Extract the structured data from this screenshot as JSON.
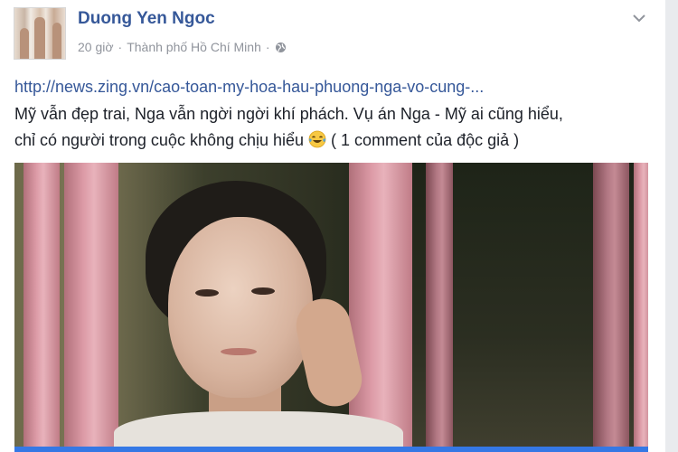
{
  "post": {
    "author": "Duong Yen Ngoc",
    "time": "20 giờ",
    "separator": "·",
    "location": "Thành phố Hồ Chí Minh",
    "separator2": "·",
    "privacy_icon": "globe-icon",
    "menu_icon": "chevron-down-icon",
    "shared_link": "http://news.zing.vn/cao-toan-my-hoa-hau-phuong-nga-vo-cung-...",
    "caption_line1": "Mỹ vẫn đẹp trai, Nga vẫn ngời ngời khí phách. Vụ án Nga - Mỹ ai cũng hiểu,",
    "caption_line2_before_emoji": "chỉ có người trong cuộc không chịu hiểu ",
    "caption_emoji": "tears-of-joy-emoji",
    "caption_line2_after_emoji": " ( 1 comment của độc giả )"
  },
  "colors": {
    "author_link": "#365899",
    "meta_text": "#90949c",
    "body_text": "#1d2129",
    "link_preview_bar": "#3578e5"
  }
}
